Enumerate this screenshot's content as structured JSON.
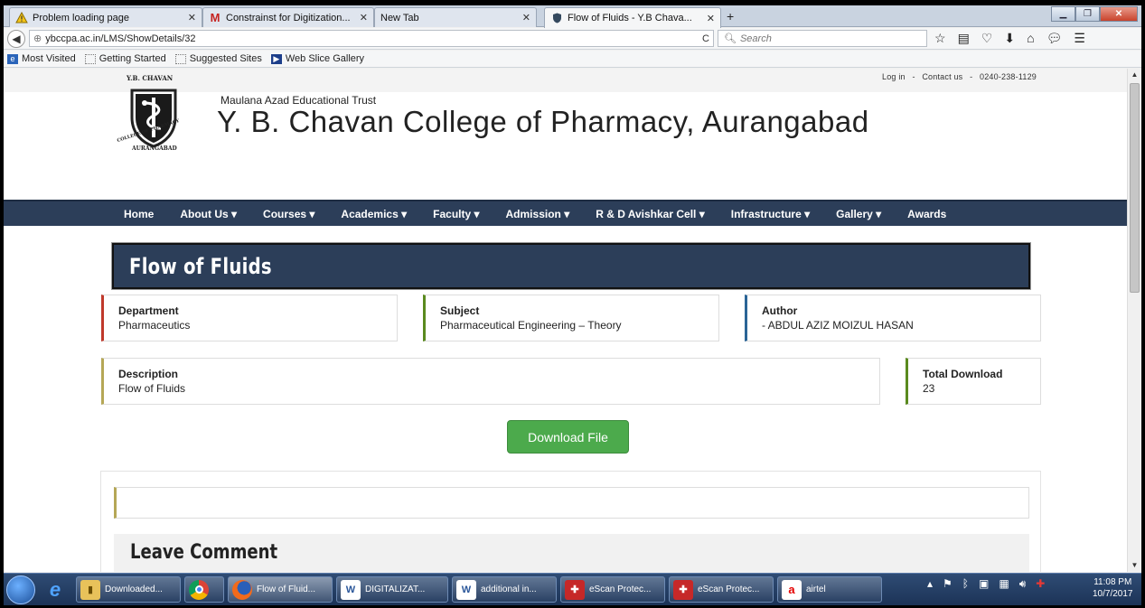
{
  "browser": {
    "tabs": [
      {
        "label": "Problem loading page",
        "icon": "warning-icon"
      },
      {
        "label": "Constrainst for Digitization...",
        "icon": "gmail-icon"
      },
      {
        "label": "New Tab",
        "icon": ""
      },
      {
        "label": "Flow of Fluids - Y.B Chava...",
        "icon": "shield-icon"
      }
    ],
    "new_tab": "+",
    "url": "ybccpa.ac.in/LMS/ShowDetails/32",
    "search_placeholder": "Search",
    "bookmarks": [
      "Most Visited",
      "Getting Started",
      "Suggested Sites",
      "Web Slice Gallery"
    ]
  },
  "site": {
    "top_links": {
      "login": "Log in",
      "sep": "-",
      "contact": "Contact us",
      "phone": "0240-238-1129"
    },
    "logo_text_top": "Y.B. CHAVAN",
    "logo_text_ring": "COLLEGE OF PHARMACY",
    "logo_text_bottom": "AURANGABAD",
    "trust": "Maulana Azad Educational Trust",
    "college": "Y. B. Chavan College of Pharmacy, Aurangabad",
    "menu": [
      "Home",
      "About Us ▾",
      "Courses ▾",
      "Academics ▾",
      "Faculty ▾",
      "Admission ▾",
      "R & D Avishkar Cell ▾",
      "Infrastructure ▾",
      "Gallery ▾",
      "Awards"
    ]
  },
  "page": {
    "title": "Flow of Fluids",
    "department": {
      "label": "Department",
      "value": "Pharmaceutics"
    },
    "subject": {
      "label": "Subject",
      "value": "Pharmaceutical Engineering – Theory"
    },
    "author": {
      "label": "Author",
      "value": "- ABDUL AZIZ MOIZUL HASAN"
    },
    "description": {
      "label": "Description",
      "value": "Flow of Fluids"
    },
    "total_download": {
      "label": "Total Download",
      "value": "23"
    },
    "download_button": "Download File",
    "leave_comment": "Leave Comment"
  },
  "taskbar": {
    "items": [
      "Downloaded...",
      "",
      "Flow of Fluid...",
      "DIGITALIZAT...",
      "additional in...",
      "eScan Protec...",
      "eScan Protec...",
      "airtel"
    ],
    "time": "11:08 PM",
    "date": "10/7/2017"
  },
  "colors": {
    "navy": "#2c3e59",
    "department_accent": "#c0392b",
    "subject_accent": "#5a8a1f",
    "author_accent": "#2a6496",
    "description_accent": "#b5a756",
    "download_accent": "#5a8a1f",
    "button_green": "#4caa4c"
  }
}
